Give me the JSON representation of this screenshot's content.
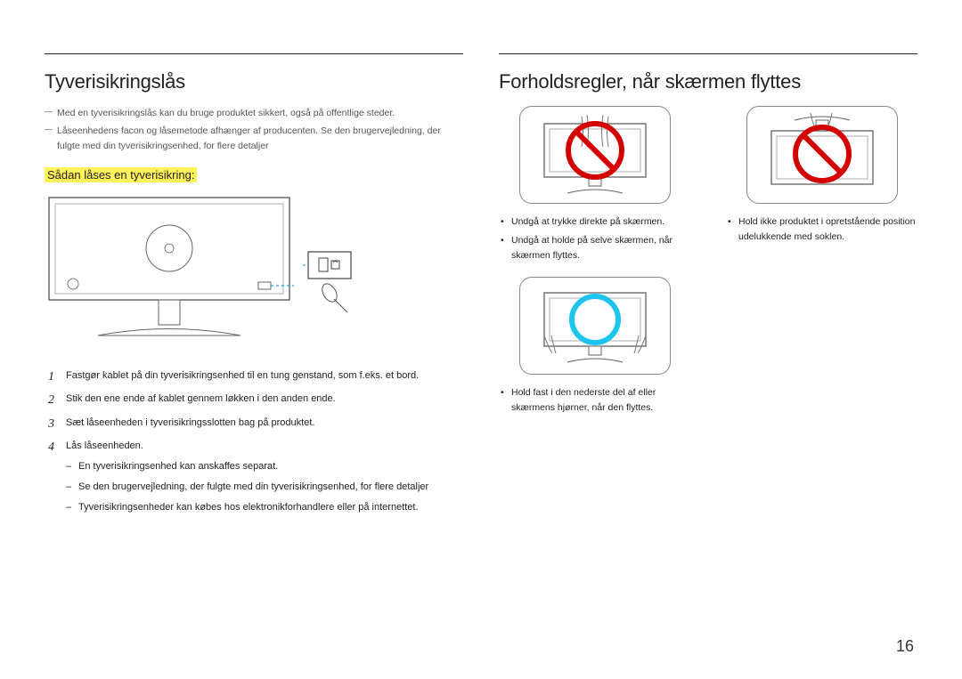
{
  "left": {
    "heading": "Tyverisikringslås",
    "intro": [
      "Med en tyverisikringslås kan du bruge produktet sikkert, også på offentlige steder.",
      "Låseenhedens facon og låsemetode afhænger af producenten. Se den brugervejledning, der fulgte med din tyverisikringsenhed, for flere detaljer"
    ],
    "subheading": "Sådan låses en tyverisikring:",
    "steps": [
      "Fastgør kablet på din tyverisikringsenhed til en tung genstand, som f.eks. et bord.",
      "Stik den ene ende af kablet gennem løkken i den anden ende.",
      "Sæt låseenheden i tyverisikringsslotten bag på produktet.",
      "Lås låseenheden."
    ],
    "substeps": [
      "En tyverisikringsenhed kan anskaffes separat.",
      "Se den brugervejledning, der fulgte med din tyverisikringsenhed, for flere detaljer",
      "Tyverisikringsenheder kan købes hos elektronikforhandlere eller på internettet."
    ]
  },
  "right": {
    "heading": "Forholdsregler, når skærmen flyttes",
    "row1": {
      "left_bullets": [
        "Undgå at trykke direkte på skærmen.",
        "Undgå at holde på selve skærmen, når skærmen flyttes."
      ],
      "right_bullets": [
        "Hold ikke produktet i opretstående position udelukkende med soklen."
      ]
    },
    "row2_bullets": [
      "Hold fast i den nederste del af eller skærmens hjørner, når den flyttes."
    ]
  },
  "page_number": "16"
}
